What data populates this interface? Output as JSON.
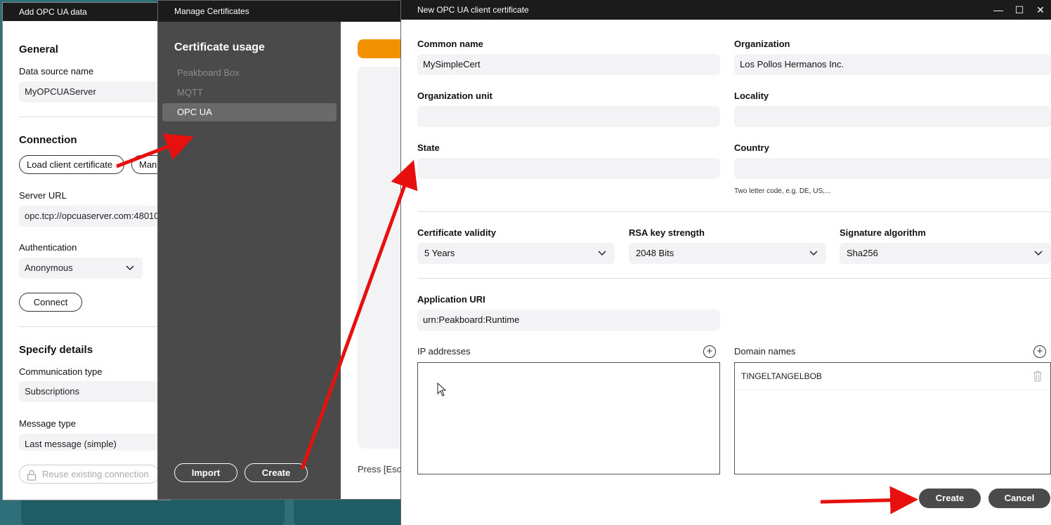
{
  "add_window": {
    "title": "Add OPC UA data",
    "general_heading": "General",
    "data_source_label": "Data source name",
    "data_source_value": "MyOPCUAServer",
    "connection_heading": "Connection",
    "load_cert_button": "Load client certificate",
    "manage_button": "Man",
    "server_url_label": "Server URL",
    "server_url_value": "opc.tcp://opcuaserver.com:48010",
    "auth_label": "Authentication",
    "auth_value": "Anonymous",
    "connect_button": "Connect",
    "details_heading": "Specify details",
    "comm_type_label": "Communication type",
    "comm_type_value": "Subscriptions",
    "msg_type_label": "Message type",
    "msg_type_value": "Last message (simple)",
    "reuse_button": "Reuse existing connection"
  },
  "manage_window": {
    "title": "Manage Certificates",
    "usage_heading": "Certificate usage",
    "items": [
      {
        "label": "Peakboard Box",
        "active": false
      },
      {
        "label": "MQTT",
        "active": false
      },
      {
        "label": "OPC UA",
        "active": true
      }
    ],
    "import_button": "Import",
    "create_button": "Create",
    "hint_text": "Press [Esc"
  },
  "new_window": {
    "title": "New OPC UA client certificate",
    "common_name_label": "Common name",
    "common_name_value": "MySimpleCert",
    "organization_label": "Organization",
    "organization_value": "Los Pollos Hermanos Inc.",
    "org_unit_label": "Organization unit",
    "org_unit_value": "",
    "locality_label": "Locality",
    "locality_value": "",
    "state_label": "State",
    "state_value": "",
    "country_label": "Country",
    "country_value": "",
    "country_hint": "Two letter code, e.g. DE, US,...",
    "validity_label": "Certificate validity",
    "validity_value": "5 Years",
    "rsa_label": "RSA key strength",
    "rsa_value": "2048 Bits",
    "sig_label": "Signature algorithm",
    "sig_value": "Sha256",
    "app_uri_label": "Application URI",
    "app_uri_value": "urn:Peakboard:Runtime",
    "ip_label": "IP addresses",
    "domain_label": "Domain names",
    "domains": [
      "TINGELTANGELBOB"
    ],
    "create_button": "Create",
    "cancel_button": "Cancel"
  },
  "colors": {
    "accent_orange": "#f39200",
    "annotation_red": "#e8100f",
    "dark_panel": "#4a4a4a",
    "titlebar": "#1b1b1b"
  }
}
